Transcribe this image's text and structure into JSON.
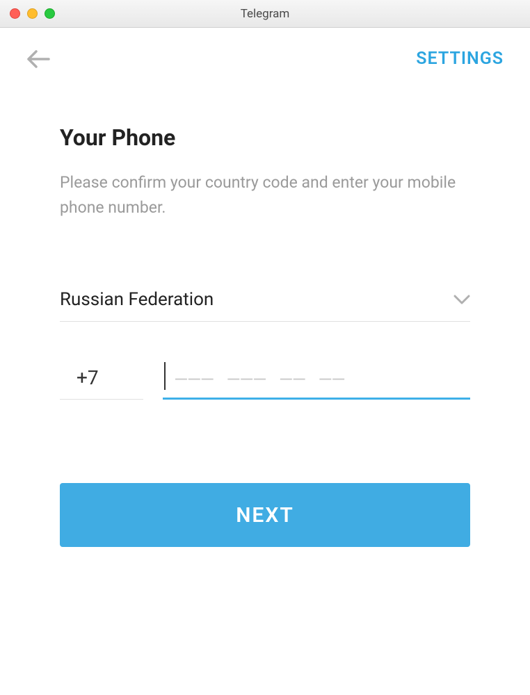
{
  "window": {
    "title": "Telegram"
  },
  "header": {
    "settings_label": "SETTINGS"
  },
  "main": {
    "heading": "Your Phone",
    "subtext": "Please confirm your country code and enter your mobile phone number.",
    "country": "Russian Federation",
    "country_code": "+7",
    "phone_placeholder": "––– ––– –– ––",
    "next_label": "NEXT"
  }
}
